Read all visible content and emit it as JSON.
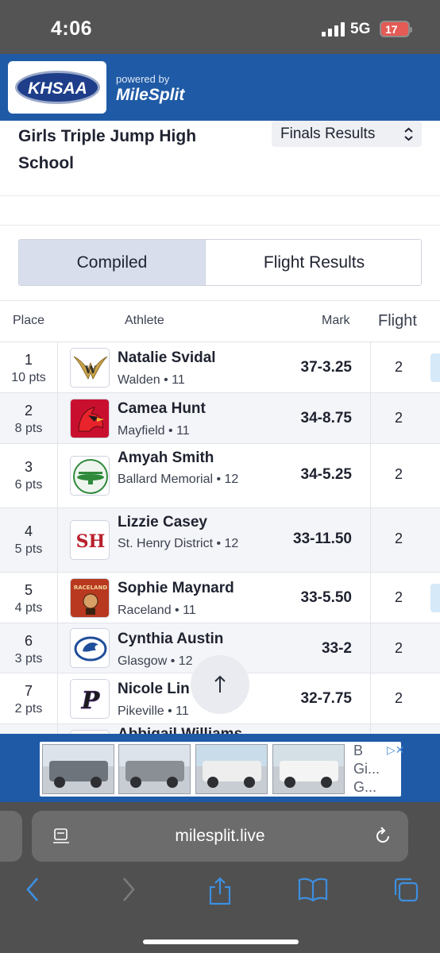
{
  "status": {
    "time": "4:06",
    "network": "5G",
    "battery": "17"
  },
  "header": {
    "logo_text": "KHSAA",
    "powered_by": "powered by",
    "brand": "MileSplit"
  },
  "event": {
    "title": "Girls Triple Jump High School",
    "round": "Finals Results"
  },
  "tabs": [
    {
      "label": "Compiled",
      "active": true
    },
    {
      "label": "Flight Results",
      "active": false
    }
  ],
  "table": {
    "headers": {
      "place": "Place",
      "athlete": "Athlete",
      "mark": "Mark",
      "flight": "Flight"
    },
    "rows": [
      {
        "place": "1",
        "pts": "10 pts",
        "name": "Natalie Svidal",
        "school": "Walden • 11",
        "mark": "37-3.25",
        "flight": "2",
        "logo": "walden-logo"
      },
      {
        "place": "2",
        "pts": "8 pts",
        "name": "Camea Hunt",
        "school": "Mayfield • 11",
        "mark": "34-8.75",
        "flight": "2",
        "logo": "mayfield-cardinal-logo"
      },
      {
        "place": "3",
        "pts": "6 pts",
        "name": "Amyah Smith",
        "school": "Ballard Memorial • 12",
        "mark": "34-5.25",
        "flight": "2",
        "logo": "ballard-memorial-logo"
      },
      {
        "place": "4",
        "pts": "5 pts",
        "name": "Lizzie Casey",
        "school": "St. Henry District • 12",
        "mark": "33-11.50",
        "flight": "2",
        "logo": "st-henry-logo",
        "logo_text": "SH"
      },
      {
        "place": "5",
        "pts": "4 pts",
        "name": "Sophie Maynard",
        "school": "Raceland • 11",
        "mark": "33-5.50",
        "flight": "2",
        "logo": "raceland-logo",
        "logo_text": "RACELAND"
      },
      {
        "place": "6",
        "pts": "3 pts",
        "name": "Cynthia Austin",
        "school": "Glasgow • 12",
        "mark": "33-2",
        "flight": "2",
        "logo": "glasgow-logo"
      },
      {
        "place": "7",
        "pts": "2 pts",
        "name": "Nicole Lin",
        "school": "Pikeville • 11",
        "mark": "32-7.75",
        "flight": "2",
        "logo": "pikeville-logo",
        "logo_text": "P"
      },
      {
        "name": "Abbigail Williams"
      }
    ]
  },
  "ad": {
    "text": "B▷ Gi... G...",
    "text_lines": [
      "B",
      "Gi...",
      "G..."
    ],
    "adchoice": "▷✕"
  },
  "browser": {
    "url": "milesplit.live"
  },
  "colors": {
    "brand_blue": "#1f5aa6",
    "tab_active": "#d9deed",
    "status_bg": "#545454",
    "safari_bg": "#505050",
    "safari_accent": "#3d8fe0"
  }
}
